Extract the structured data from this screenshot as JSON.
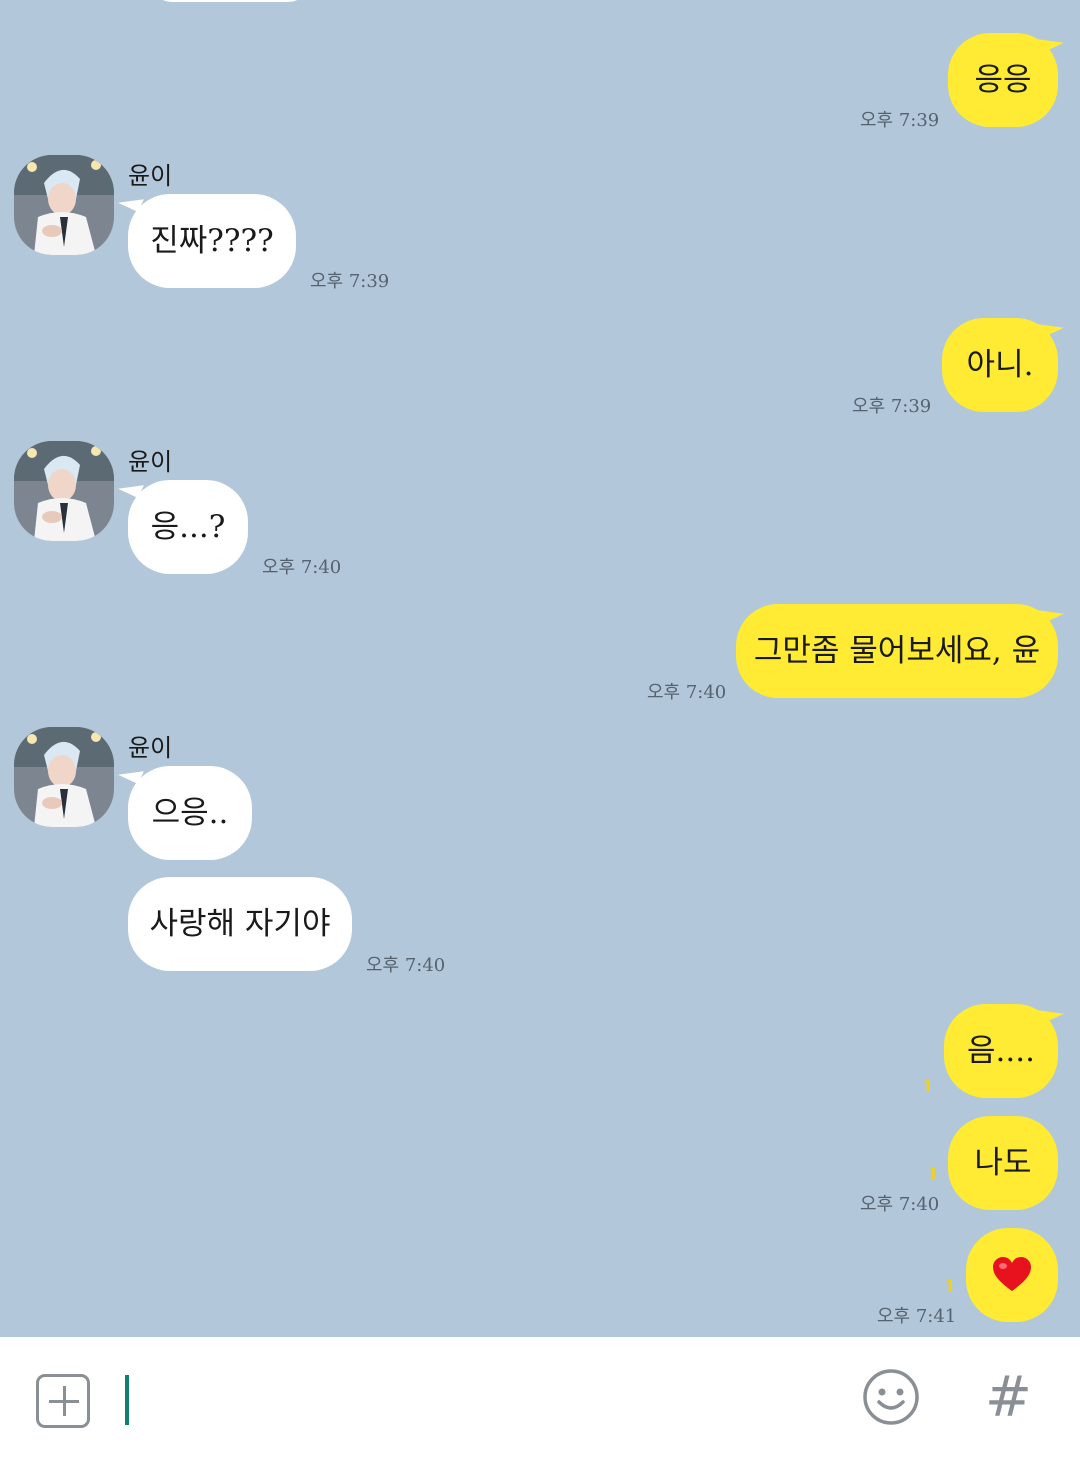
{
  "contact": {
    "name": "윤이"
  },
  "messages": [
    {
      "from": "me",
      "text": "응응",
      "time": "오후 7:39"
    },
    {
      "from": "them",
      "text": "진짜????",
      "time": "오후 7:39"
    },
    {
      "from": "me",
      "text": "아니.",
      "time": "오후 7:39"
    },
    {
      "from": "them",
      "text": "응...?",
      "time": "오후 7:40"
    },
    {
      "from": "me",
      "text": "그만좀 물어보세요, 윤",
      "time": "오후 7:40"
    },
    {
      "from": "them",
      "text": "으응..",
      "time": ""
    },
    {
      "from": "them",
      "text": "사랑해 자기야",
      "time": "오후 7:40"
    },
    {
      "from": "me",
      "text": "음....",
      "unread": "1",
      "time": ""
    },
    {
      "from": "me",
      "text": "나도",
      "unread": "1",
      "time": "오후 7:40"
    },
    {
      "from": "me",
      "text": "❤️",
      "unread": "1",
      "time": "오후 7:41"
    }
  ],
  "input": {
    "value": "",
    "placeholder": ""
  },
  "icons": {
    "attach": "plus-square-icon",
    "emoji": "smiley-icon",
    "hashtag": "hash-icon"
  },
  "colors": {
    "background": "#b2c7da",
    "my_bubble": "#ffeb33",
    "their_bubble": "#ffffff",
    "caret": "#137f70"
  },
  "toolbar": {
    "hash_label": "#"
  }
}
